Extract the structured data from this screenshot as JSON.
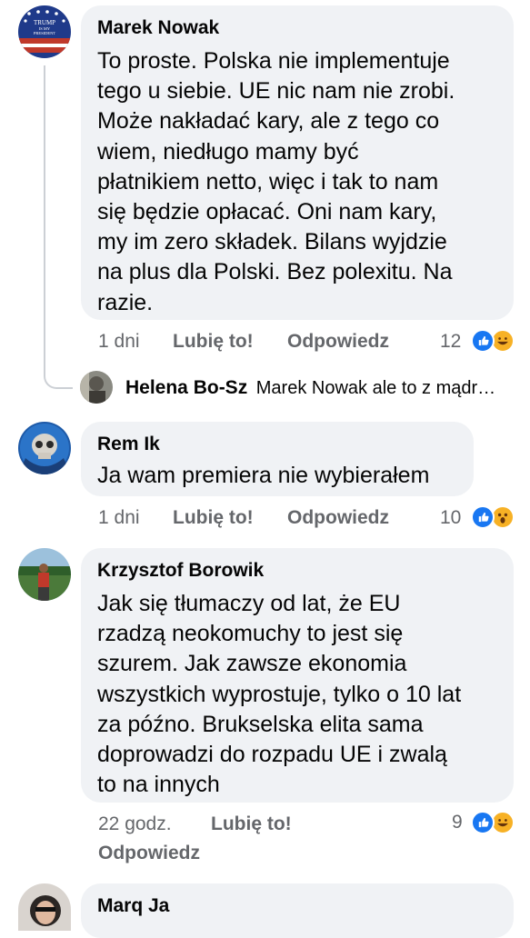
{
  "comments": [
    {
      "author": "Marek Nowak",
      "text": "To proste. Polska nie implementuje\ntego u siebie. UE nic nam nie zrobi.\nMoże nakładać kary, ale z tego co\nwiem, niedługo mamy być\npłatnikiem netto, więc i tak to nam\nsię będzie opłacać. Oni nam kary,\nmy im zero składek. Bilans wyjdzie\nna plus dla Polski. Bez polexitu. Na\nrazie.",
      "time": "1 dni",
      "like_label": "Lubię to!",
      "reply_label": "Odpowiedz",
      "reaction_count": "12",
      "reactions": [
        "like",
        "haha"
      ],
      "avatar_text": [
        "TRUMP",
        "IS MY",
        "PRESIDENT"
      ]
    },
    {
      "author": "Rem Ik",
      "text": "Ja wam premiera nie wybierałem",
      "time": "1 dni",
      "like_label": "Lubię to!",
      "reply_label": "Odpowiedz",
      "reaction_count": "10",
      "reactions": [
        "like",
        "wow"
      ]
    },
    {
      "author": "Krzysztof Borowik",
      "text": "Jak się tłumaczy od lat, że EU\nrzadzą neokomuchy to jest się\nszurem. Jak zawsze ekonomia\nwszystkich wyprostuje, tylko o 10 lat\nza późno. Brukselska elita sama\ndoprowadzi do rozpadu UE i zwalą\nto na innych",
      "time": "22 godz.",
      "like_label": "Lubię to!",
      "reply_label": "Odpowiedz",
      "reaction_count": "9",
      "reactions": [
        "like",
        "haha"
      ]
    },
    {
      "author": "Marq Ja"
    }
  ],
  "reply_preview": {
    "author": "Helena Bo-Sz",
    "text": "Marek Nowak ale to z mądr…"
  },
  "colors": {
    "bubble": "#f0f2f5",
    "meta": "#65676b",
    "like": "#1877f2",
    "emoji": "#f7b125"
  }
}
